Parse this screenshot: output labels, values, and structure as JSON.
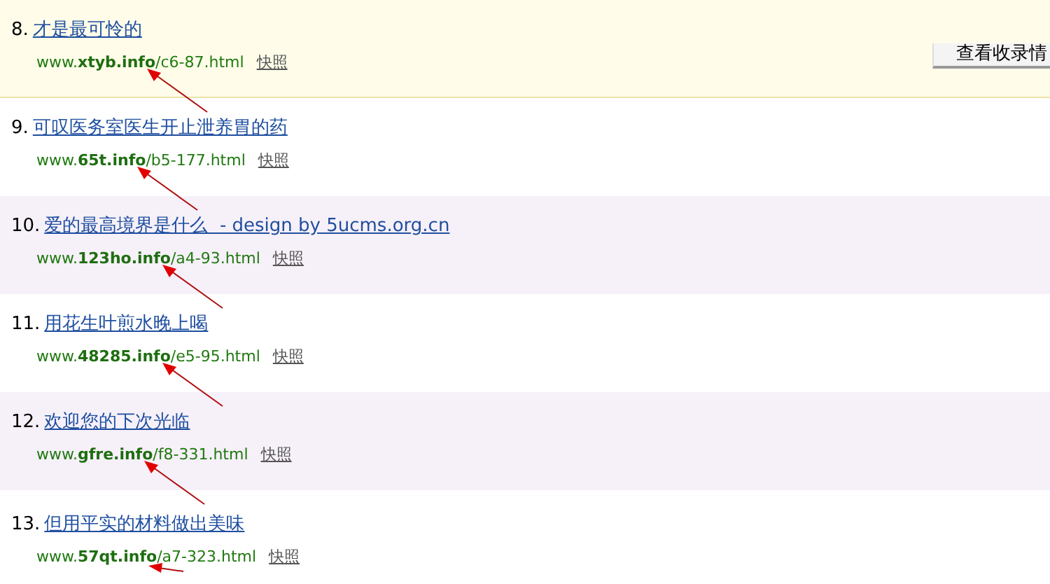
{
  "results": [
    {
      "number": "8.",
      "title": "才是最可怜的",
      "url": "www.**xtyb.info**/c6-87.html",
      "snapshot": "快照",
      "kind": "highlighted",
      "arrow": {
        "kind": "long"
      }
    },
    {
      "number": "9.",
      "title": "可叹医务室医生开止泄养胃的药",
      "url": "www.**65t.info**/b5-177.html",
      "snapshot": "快照",
      "kind": "plain",
      "arrow": {
        "kind": "long"
      }
    },
    {
      "number": "10.",
      "title": "爱的最高境界是什么  - design by 5ucms.org.cn",
      "url": "www.**123ho.info**/a4-93.html",
      "snapshot": "快照",
      "kind": "alternate",
      "arrow": {
        "kind": "long"
      }
    },
    {
      "number": "11.",
      "title": "用花生叶煎水晚上喝",
      "url": "www.**48285.info**/e5-95.html",
      "snapshot": "快照",
      "kind": "plain",
      "arrow": {
        "kind": "long"
      }
    },
    {
      "number": "12.",
      "title": "欢迎您的下次光临",
      "url": "www.**gfre.info**/f8-331.html",
      "snapshot": "快照",
      "kind": "alternate",
      "arrow": {
        "kind": "long"
      }
    },
    {
      "number": "13.",
      "title": "但用平实的材料做出美味",
      "url": "www.**57qt.info**/a7-323.html",
      "snapshot": "快照",
      "kind": "plain",
      "arrow": {
        "kind": "short"
      }
    }
  ],
  "side_button": "查看收录情"
}
